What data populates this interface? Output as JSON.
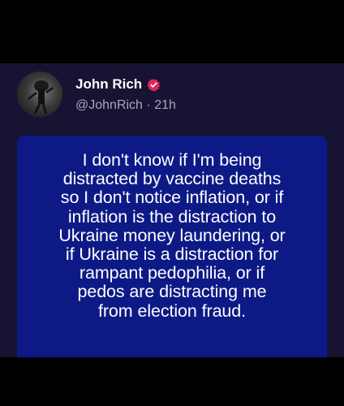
{
  "post": {
    "author_name": "John Rich",
    "handle": "@JohnRich",
    "separator": "·",
    "time": "21h",
    "verified_color": "#e0245e",
    "image_text": "I don't know if I'm being\ndistracted by vaccine deaths\nso I don't notice inflation, or if\ninflation is the distraction to\nUkraine money laundering, or\nif Ukraine is a distraction for\nrampant pedophilia, or if\npedos are distracting me\nfrom election fraud."
  },
  "colors": {
    "background": "#000000",
    "post_background": "#161432",
    "image_background": "#0d1a86",
    "handle_text": "#a9a7bd"
  }
}
